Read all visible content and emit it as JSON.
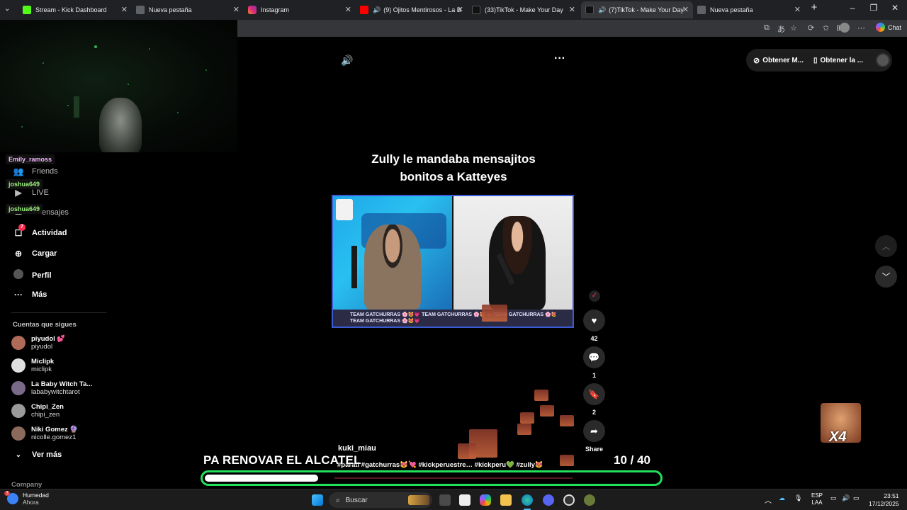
{
  "browser": {
    "tabs": [
      {
        "label": "Stream - Kick Dashboard",
        "fav": "#53fc18"
      },
      {
        "label": "Nueva pestaña",
        "fav": "#5f6368"
      },
      {
        "label": "Instagram",
        "fav": "#e1306c"
      },
      {
        "label": "(9) Ojitos Mentirosos - La Bel",
        "fav": "#ff0000"
      },
      {
        "label": "(33)TikTok - Make Your Day",
        "fav": "#111111"
      },
      {
        "label": "(7)TikTok - Make Your Day",
        "fav": "#111111"
      },
      {
        "label": "Nueva pestaña",
        "fav": "#5f6368"
      }
    ],
    "chat_label": "Chat"
  },
  "chat_overlay": {
    "users": [
      "Emily_ramoss",
      "joshua649",
      "joshua649"
    ]
  },
  "sidebar": {
    "partial_items": [
      "Friends",
      "LIVE",
      "ensajes"
    ],
    "items": [
      {
        "icon": "☐",
        "label": "Actividad",
        "badge": "7"
      },
      {
        "icon": "⊕",
        "label": "Cargar"
      },
      {
        "icon": "◉",
        "label": "Perfil"
      },
      {
        "icon": "···",
        "label": "Más"
      }
    ],
    "following_title": "Cuentas que sigues",
    "accounts": [
      {
        "name": "piyudol 💕",
        "handle": "piyudol",
        "color": "#b06a5a"
      },
      {
        "name": "Miclipk",
        "handle": "miclipk",
        "color": "#e0e0e0"
      },
      {
        "name": "La Baby Witch Ta...",
        "handle": "lababywitchtarot",
        "color": "#7a6a8a"
      },
      {
        "name": "Chipi_Zen",
        "handle": "chipi_zen",
        "color": "#9a9a9a"
      },
      {
        "name": "Niki Gomez 🔮",
        "handle": "nicolle.gomez1",
        "color": "#8a6a5a"
      }
    ],
    "see_more": "Ver más",
    "company": "Company"
  },
  "top_pill": {
    "btn1": "Obtener M...",
    "btn2": "Obtener la ..."
  },
  "video": {
    "title_line1": "Zully le mandaba mensajitos",
    "title_line2": "bonitos a Katteyes",
    "lower_third_1": "TEAM GATCHURRAS 🌸😻💗 TEAM GATCHURRAS 🌸😻💗 TEAM GATCHURRAS 🌸😻💗",
    "lower_third_2": "TEAM GATCHURRAS 🌸😻💗",
    "author": "kuki_miau",
    "hashtags": "#parati #gatchurras😻💘  #kickperuestre…  #kickperu💚 #zully😻"
  },
  "actions": {
    "likes": "42",
    "comments": "1",
    "saves": "2",
    "share": "Share"
  },
  "goal": {
    "label": "PA RENOVAR EL ALCATEL",
    "current": "10",
    "total": "/ 40",
    "progress": 0.25
  },
  "multiplier": "X4",
  "taskbar": {
    "weather_title": "Humedad",
    "weather_sub": "Ahora",
    "weather_badge": "3",
    "search": "Buscar",
    "lang_1": "ESP",
    "lang_2": "LAA",
    "time": "23:51",
    "date": "17/12/2025"
  }
}
